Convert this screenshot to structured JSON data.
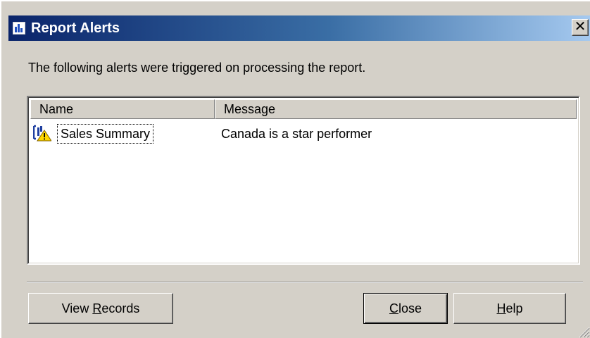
{
  "window": {
    "title": "Report Alerts",
    "close_glyph": "✕",
    "icon": "report-icon"
  },
  "intro_text": "The following alerts were triggered on processing the report.",
  "list": {
    "columns": [
      "Name",
      "Message"
    ],
    "rows": [
      {
        "icon": "alert-warning-icon",
        "name": "Sales Summary",
        "message": "Canada is a star performer"
      }
    ]
  },
  "buttons": {
    "view_records": {
      "prefix": "View ",
      "mnemonic": "R",
      "suffix": "ecords"
    },
    "close": {
      "prefix": "",
      "mnemonic": "C",
      "suffix": "lose"
    },
    "help": {
      "prefix": "",
      "mnemonic": "H",
      "suffix": "elp"
    }
  },
  "colors": {
    "title_gradient_start": "#0a246a",
    "title_gradient_end": "#a6caf0",
    "face": "#d4d0c8",
    "warning": "#ffd800"
  }
}
